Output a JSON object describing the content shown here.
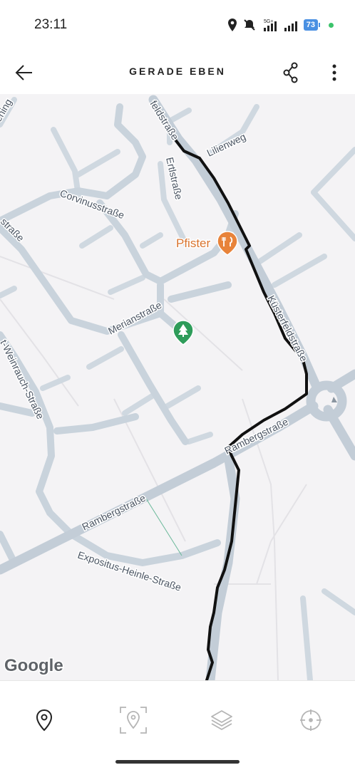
{
  "status_bar": {
    "time": "23:11",
    "network_label": "5G+",
    "battery_level": "73"
  },
  "app_bar": {
    "title": "GERADE EBEN",
    "back_icon": "arrow-left-icon",
    "share_icon": "share-icon",
    "menu_icon": "more-vert-icon"
  },
  "map": {
    "streets": {
      "feldstrasse": "feldstraße",
      "lilienweg": "Lilienweg",
      "ertlstrasse": "Ertlstraße",
      "corvinusstrasse": "Corvinusstraße",
      "strasse_left": "straße",
      "merianstrasse": "Merianstraße",
      "kuesterfeldstrasse": "Küsterfeldstraße",
      "weinrauch_strasse": "t-Weinrauch-Straße",
      "rambergstrasse_1": "Rambergstraße",
      "rambergstrasse_2": "Rambergstraße",
      "expositus_heinle_strasse": "Expositus-Heinle-Straße",
      "ening": "ening"
    },
    "poi": {
      "restaurant_name": "Pfister",
      "restaurant_icon": "fork-knife-icon",
      "park_icon": "tree-icon"
    },
    "attribution": "Google",
    "colors": {
      "route": "#111111",
      "road": "#c9d3dc",
      "background": "#f4f3f5",
      "poi_orange": "#e8833a",
      "park_green": "#2e9c5a"
    }
  },
  "bottom_nav": {
    "items": [
      {
        "icon": "location-pin-icon"
      },
      {
        "icon": "focus-location-icon"
      },
      {
        "icon": "layers-icon"
      },
      {
        "icon": "crosshair-icon"
      }
    ]
  }
}
